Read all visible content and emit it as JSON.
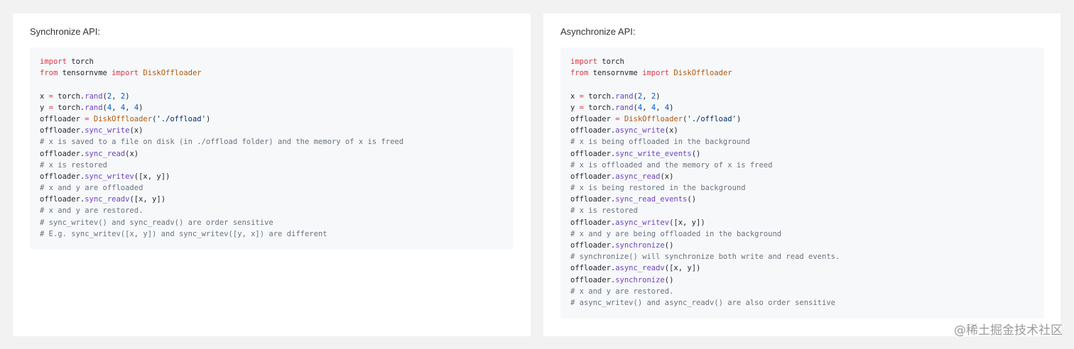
{
  "sync_panel": {
    "title": "Synchronize API:",
    "lines": [
      [
        [
          "kw",
          "import"
        ],
        [
          "plain",
          " torch"
        ]
      ],
      [
        [
          "kw",
          "from"
        ],
        [
          "plain",
          " tensornvme "
        ],
        [
          "kw",
          "import"
        ],
        [
          "plain",
          " "
        ],
        [
          "cls",
          "DiskOffloader"
        ]
      ],
      [
        [
          "plain",
          ""
        ]
      ],
      [
        [
          "plain",
          "x "
        ],
        [
          "op",
          "="
        ],
        [
          "plain",
          " torch."
        ],
        [
          "fn",
          "rand"
        ],
        [
          "plain",
          "("
        ],
        [
          "num",
          "2"
        ],
        [
          "plain",
          ", "
        ],
        [
          "num",
          "2"
        ],
        [
          "plain",
          ")"
        ]
      ],
      [
        [
          "plain",
          "y "
        ],
        [
          "op",
          "="
        ],
        [
          "plain",
          " torch."
        ],
        [
          "fn",
          "rand"
        ],
        [
          "plain",
          "("
        ],
        [
          "num",
          "4"
        ],
        [
          "plain",
          ", "
        ],
        [
          "num",
          "4"
        ],
        [
          "plain",
          ", "
        ],
        [
          "num",
          "4"
        ],
        [
          "plain",
          ")"
        ]
      ],
      [
        [
          "plain",
          "offloader "
        ],
        [
          "op",
          "="
        ],
        [
          "plain",
          " "
        ],
        [
          "cls",
          "DiskOffloader"
        ],
        [
          "plain",
          "("
        ],
        [
          "str",
          "'./offload'"
        ],
        [
          "plain",
          ")"
        ]
      ],
      [
        [
          "plain",
          "offloader."
        ],
        [
          "fn",
          "sync_write"
        ],
        [
          "plain",
          "(x)"
        ]
      ],
      [
        [
          "com",
          "# x is saved to a file on disk (in ./offload folder) and the memory of x is freed"
        ]
      ],
      [
        [
          "plain",
          "offloader."
        ],
        [
          "fn",
          "sync_read"
        ],
        [
          "plain",
          "(x)"
        ]
      ],
      [
        [
          "com",
          "# x is restored"
        ]
      ],
      [
        [
          "plain",
          "offloader."
        ],
        [
          "fn",
          "sync_writev"
        ],
        [
          "plain",
          "([x, y])"
        ]
      ],
      [
        [
          "com",
          "# x and y are offloaded"
        ]
      ],
      [
        [
          "plain",
          "offloader."
        ],
        [
          "fn",
          "sync_readv"
        ],
        [
          "plain",
          "([x, y])"
        ]
      ],
      [
        [
          "com",
          "# x and y are restored."
        ]
      ],
      [
        [
          "com",
          "# sync_writev() and sync_readv() are order sensitive"
        ]
      ],
      [
        [
          "com",
          "# E.g. sync_writev([x, y]) and sync_writev([y, x]) are different"
        ]
      ]
    ]
  },
  "async_panel": {
    "title": "Asynchronize API:",
    "lines": [
      [
        [
          "kw",
          "import"
        ],
        [
          "plain",
          " torch"
        ]
      ],
      [
        [
          "kw",
          "from"
        ],
        [
          "plain",
          " tensornvme "
        ],
        [
          "kw",
          "import"
        ],
        [
          "plain",
          " "
        ],
        [
          "cls",
          "DiskOffloader"
        ]
      ],
      [
        [
          "plain",
          ""
        ]
      ],
      [
        [
          "plain",
          "x "
        ],
        [
          "op",
          "="
        ],
        [
          "plain",
          " torch."
        ],
        [
          "fn",
          "rand"
        ],
        [
          "plain",
          "("
        ],
        [
          "num",
          "2"
        ],
        [
          "plain",
          ", "
        ],
        [
          "num",
          "2"
        ],
        [
          "plain",
          ")"
        ]
      ],
      [
        [
          "plain",
          "y "
        ],
        [
          "op",
          "="
        ],
        [
          "plain",
          " torch."
        ],
        [
          "fn",
          "rand"
        ],
        [
          "plain",
          "("
        ],
        [
          "num",
          "4"
        ],
        [
          "plain",
          ", "
        ],
        [
          "num",
          "4"
        ],
        [
          "plain",
          ", "
        ],
        [
          "num",
          "4"
        ],
        [
          "plain",
          ")"
        ]
      ],
      [
        [
          "plain",
          "offloader "
        ],
        [
          "op",
          "="
        ],
        [
          "plain",
          " "
        ],
        [
          "cls",
          "DiskOffloader"
        ],
        [
          "plain",
          "("
        ],
        [
          "str",
          "'./offload'"
        ],
        [
          "plain",
          ")"
        ]
      ],
      [
        [
          "plain",
          "offloader."
        ],
        [
          "fn",
          "async_write"
        ],
        [
          "plain",
          "(x)"
        ]
      ],
      [
        [
          "com",
          "# x is being offloaded in the background"
        ]
      ],
      [
        [
          "plain",
          "offloader."
        ],
        [
          "fn",
          "sync_write_events"
        ],
        [
          "plain",
          "()"
        ]
      ],
      [
        [
          "com",
          "# x is offloaded and the memory of x is freed"
        ]
      ],
      [
        [
          "plain",
          "offloader."
        ],
        [
          "fn",
          "async_read"
        ],
        [
          "plain",
          "(x)"
        ]
      ],
      [
        [
          "com",
          "# x is being restored in the background"
        ]
      ],
      [
        [
          "plain",
          "offloader."
        ],
        [
          "fn",
          "sync_read_events"
        ],
        [
          "plain",
          "()"
        ]
      ],
      [
        [
          "com",
          "# x is restored"
        ]
      ],
      [
        [
          "plain",
          "offloader."
        ],
        [
          "fn",
          "async_writev"
        ],
        [
          "plain",
          "([x, y])"
        ]
      ],
      [
        [
          "com",
          "# x and y are being offloaded in the background"
        ]
      ],
      [
        [
          "plain",
          "offloader."
        ],
        [
          "fn",
          "synchronize"
        ],
        [
          "plain",
          "()"
        ]
      ],
      [
        [
          "com",
          "# synchronize() will synchronize both write and read events."
        ]
      ],
      [
        [
          "plain",
          "offloader."
        ],
        [
          "fn",
          "async_readv"
        ],
        [
          "plain",
          "([x, y])"
        ]
      ],
      [
        [
          "plain",
          "offloader."
        ],
        [
          "fn",
          "synchronize"
        ],
        [
          "plain",
          "()"
        ]
      ],
      [
        [
          "com",
          "# x and y are restored."
        ]
      ],
      [
        [
          "com",
          "# async_writev() and async_readv() are also order sensitive"
        ]
      ]
    ]
  },
  "watermark": "@稀土掘金技术社区"
}
